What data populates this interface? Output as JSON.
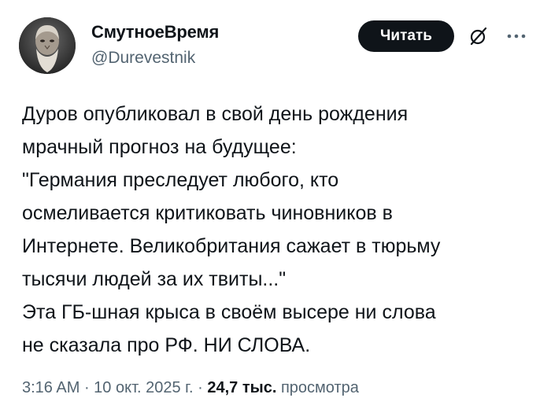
{
  "author": {
    "display_name": "СмутноеВремя",
    "handle": "@Durevestnik"
  },
  "actions": {
    "follow_label": "Читать",
    "grok_icon": "grok-slash-icon",
    "more_icon": "more-dots-icon"
  },
  "tweet": {
    "lines": [
      "Дуров опубликовал в свой день рождения",
      "мрачный прогноз на будущее:",
      "\"Германия преследует любого, кто",
      "осмеливается критиковать чиновников в",
      "Интернете. Великобритания сажает в тюрьму",
      "тысячи людей за их твиты...\"",
      "Эта ГБ-шная крыса в своём высере ни слова",
      "не сказала про РФ. НИ СЛОВА."
    ]
  },
  "meta": {
    "time": "3:16 AM",
    "sep1": " · ",
    "date": "10 окт. 2025 г.",
    "sep2": " · ",
    "views_count": "24,7 тыс.",
    "views_label": " просмотра"
  },
  "colors": {
    "text_primary": "#0f1419",
    "text_secondary": "#536471",
    "button_bg": "#0f1419",
    "button_text": "#ffffff"
  }
}
